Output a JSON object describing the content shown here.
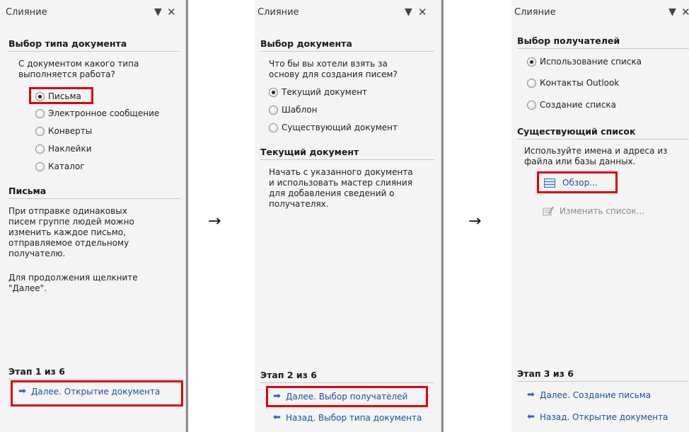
{
  "panes": [
    {
      "title": "Слияние",
      "section1": "Выбор типа документа",
      "prompt": [
        "С документом какого типа",
        "выполняется работа?"
      ],
      "options": [
        "Письма",
        "Электронное сообщение",
        "Конверты",
        "Наклейки",
        "Каталог"
      ],
      "selected": "Письма",
      "section2": "Письма",
      "desc": [
        "При отправке одинаковых",
        "писем группе людей можно",
        "изменить каждое письмо,",
        "отправляемое отдельному",
        "получателю."
      ],
      "desc2": [
        "Для продолжения щелкните",
        "\"Далее\"."
      ],
      "step": "Этап 1 из 6",
      "next": "Далее. Открытие документа"
    },
    {
      "title": "Слияние",
      "section1": "Выбор документа",
      "prompt": [
        "Что бы вы хотели взять за",
        "основу для создания писем?"
      ],
      "options": [
        "Текущий документ",
        "Шаблон",
        "Существующий документ"
      ],
      "selected": "Текущий документ",
      "section2": "Текущий документ",
      "desc": [
        "Начать с указанного документа",
        "и использовать мастер слияния",
        "для добавления сведений о",
        "получателях."
      ],
      "step": "Этап 2 из 6",
      "next": "Далее. Выбор получателей",
      "back": "Назад. Выбор типа документа"
    },
    {
      "title": "Слияние",
      "section1": "Выбор получателей",
      "options": [
        "Использование списка",
        "Контакты Outlook",
        "Создание списка"
      ],
      "selected": "Использование списка",
      "section2": "Существующий список",
      "desc": [
        "Используйте имена и адреса из",
        "файла или базы данных."
      ],
      "browse": "Обзор...",
      "edit": "Изменить список...",
      "step": "Этап 3 из 6",
      "next": "Далее. Создание письма",
      "back": "Назад. Открытие документа"
    }
  ],
  "arrows": [
    "→",
    "→"
  ],
  "icons": {
    "dropdown": "chevron-down-icon",
    "close": "close-icon",
    "next": "arrow-right-icon",
    "back": "arrow-left-icon",
    "browse": "table-icon",
    "edit": "edit-list-icon"
  },
  "colors": {
    "highlight": "#e0000b",
    "link": "#1a4f9e",
    "pane": "#f4f4f4"
  }
}
